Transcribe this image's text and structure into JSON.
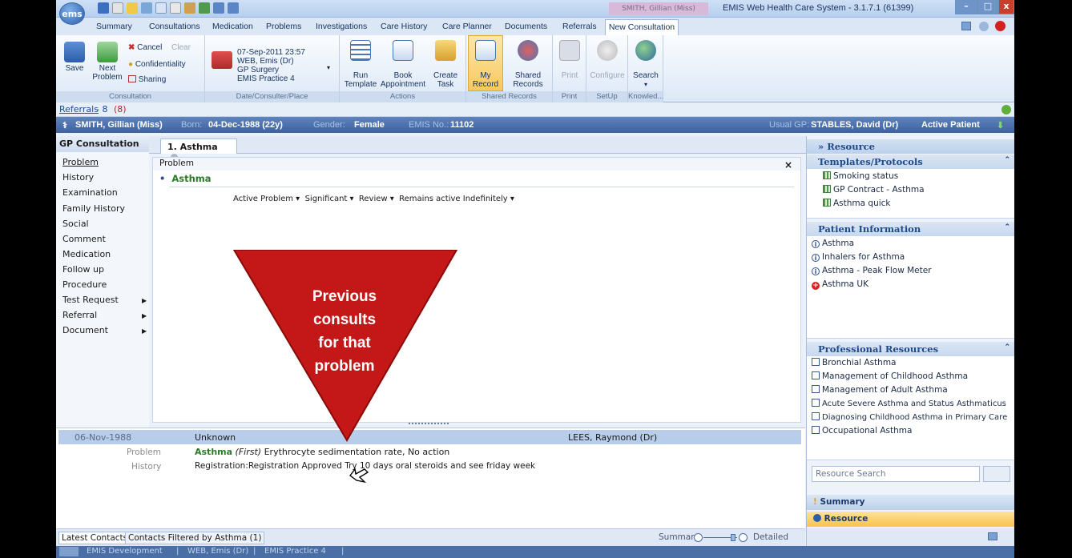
{
  "window": {
    "title": "EMIS Web Health Care System - 3.1.7.1 (61399)",
    "patient_title": "SMITH, Gillian (Miss)",
    "logo": "ems"
  },
  "ribbon_tabs": [
    "Summary",
    "Consultations",
    "Medication",
    "Problems",
    "Investigations",
    "Care History",
    "Care Planner",
    "Documents",
    "Referrals",
    "New Consultation"
  ],
  "ribbon": {
    "consultation": {
      "label": "Consultation",
      "save": "Save",
      "next_problem_1": "Next",
      "next_problem_2": "Problem",
      "cancel": "Cancel",
      "clear": "Clear",
      "confidentiality": "Confidentiality",
      "sharing": "Sharing"
    },
    "date_consulter": {
      "label": "Date/Consulter/Place",
      "line1": "07-Sep-2011 23:57",
      "line2": "WEB, Emis (Dr)",
      "line3": "GP Surgery",
      "line4": "EMIS Practice 4"
    },
    "actions": {
      "label": "Actions",
      "run_1": "Run",
      "run_2": "Template",
      "book_1": "Book",
      "book_2": "Appointment",
      "create_1": "Create",
      "create_2": "Task"
    },
    "shared": {
      "label": "Shared Records",
      "my_1": "My",
      "my_2": "Record",
      "shared_1": "Shared",
      "shared_2": "Records"
    },
    "print": {
      "label": "Print",
      "print": "Print"
    },
    "setup": {
      "label": "SetUp",
      "configure": "Configure"
    },
    "knowledge": {
      "label": "Knowled...",
      "search": "Search"
    }
  },
  "referrals": {
    "label": "Referrals",
    "count": "- 8",
    "highlight": "(8)"
  },
  "banner": {
    "name": "SMITH, Gillian (Miss)",
    "born_label": "Born:",
    "born": "04-Dec-1988 (22y)",
    "gender_label": "Gender:",
    "gender": "Female",
    "emis_label": "EMIS No.:",
    "emis": "11102",
    "gp_label": "Usual GP:",
    "gp": "STABLES, David (Dr)",
    "status": "Active Patient"
  },
  "nav": {
    "heading": "GP Consultation",
    "items": [
      "Problem",
      "History",
      "Examination",
      "Family History",
      "Social",
      "Comment",
      "Medication",
      "Follow up",
      "Procedure",
      "Test Request",
      "Referral",
      "Document"
    ]
  },
  "consult_tab": "1. Asthma",
  "problem": {
    "section": "Problem",
    "name": "Asthma",
    "options": [
      "Active Problem",
      "Significant",
      "Review",
      "Remains active Indefinitely"
    ]
  },
  "overlay": {
    "line1": "Previous",
    "line2": "consults",
    "line3": "for that",
    "line4": "problem"
  },
  "previous": {
    "date": "06-Nov-1988",
    "who": "Unknown",
    "clinician": "LEES, Raymond (Dr)",
    "row1_label": "Problem",
    "row1_name": "Asthma",
    "row1_first": "(First)",
    "row1_text": "Erythrocyte sedimentation rate, No action",
    "row2_label": "History",
    "row2_text": "Registration:Registration Approved  Try 10 days oral steroids and see friday week"
  },
  "bottom": {
    "tab1": "Latest Contacts",
    "tab2": "Contacts Filtered by Asthma (1)",
    "summary": "Summary",
    "detailed": "Detailed"
  },
  "status": {
    "a": "EMIS Development",
    "b": "WEB, Emis (Dr)",
    "c": "EMIS Practice 4"
  },
  "resource": {
    "header": "Resource",
    "templates_title": "Templates/Protocols",
    "templates": [
      "Smoking status",
      "GP Contract - Asthma",
      "Asthma quick"
    ],
    "patient_info_title": "Patient Information",
    "patient_info": [
      "Asthma",
      "Inhalers for Asthma",
      "Asthma - Peak Flow Meter",
      "Asthma UK"
    ],
    "professional_title": "Professional Resources",
    "professional": [
      "Bronchial Asthma",
      "Management of Childhood Asthma",
      "Management of Adult Asthma",
      "Acute Severe Asthma and Status Asthmaticus",
      "Diagnosing Childhood Asthma in Primary Care",
      "Occupational Asthma"
    ],
    "search_placeholder": "Resource Search",
    "summary_bar": "Summary",
    "resource_bar": "Resource"
  }
}
